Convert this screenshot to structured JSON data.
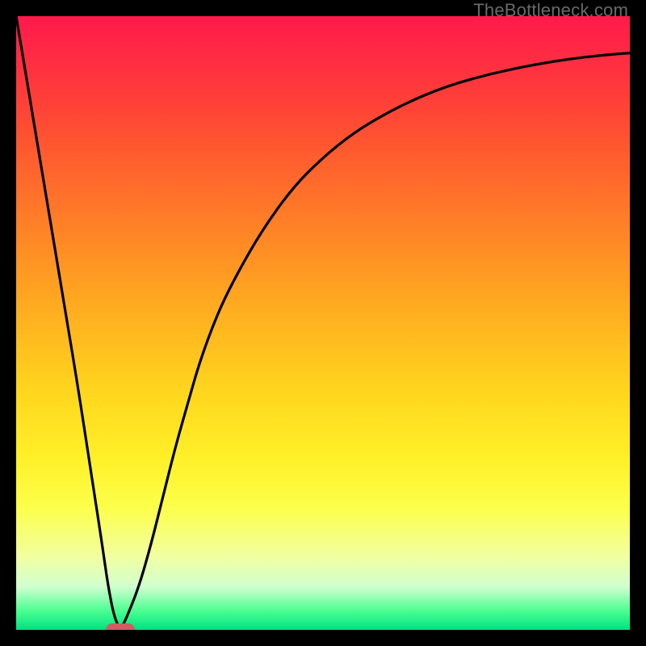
{
  "watermark": "TheBottleneck.com",
  "colors": {
    "curve_stroke": "#000000",
    "marker_fill": "#cf5d62",
    "frame": "#000000"
  },
  "chart_data": {
    "type": "line",
    "title": "",
    "xlabel": "",
    "ylabel": "",
    "xlim": [
      0,
      100
    ],
    "ylim": [
      0,
      100
    ],
    "grid": false,
    "legend": false,
    "x": [
      0,
      2,
      4,
      6,
      8,
      10,
      12,
      14,
      15,
      16,
      17,
      18,
      20,
      22,
      24,
      26,
      28,
      30,
      33,
      36,
      40,
      45,
      50,
      55,
      60,
      65,
      70,
      75,
      80,
      85,
      90,
      95,
      100
    ],
    "values": [
      100,
      88,
      76,
      64,
      52,
      40,
      27,
      14,
      7,
      2,
      0,
      2,
      7,
      14,
      22,
      30,
      37,
      44,
      52,
      58,
      65,
      72,
      77,
      81,
      84,
      86.5,
      88.5,
      90,
      91.2,
      92.2,
      93,
      93.6,
      94
    ],
    "marker": {
      "x": 17,
      "y": 0
    },
    "gradient_top_color": "#ff1a4a",
    "gradient_bottom_color": "#00e082"
  }
}
